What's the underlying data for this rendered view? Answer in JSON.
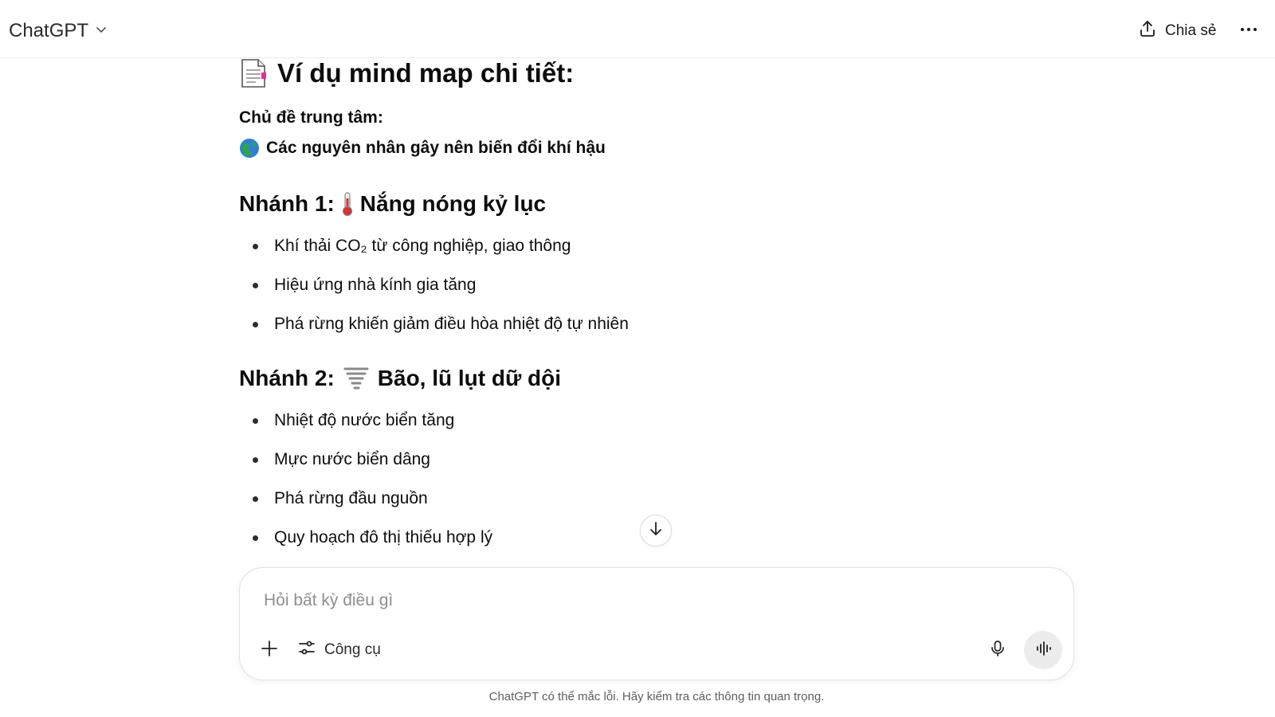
{
  "header": {
    "model_name": "ChatGPT",
    "share_label": "Chia sẻ"
  },
  "message": {
    "title": "Ví dụ mind map chi tiết:",
    "center_label": "Chủ đề trung tâm:",
    "center_topic": "Các nguyên nhân gây nên biến đổi khí hậu",
    "branches": [
      {
        "prefix": "Nhánh 1:",
        "name": "Nắng nóng kỷ lục",
        "icon": "thermometer-icon",
        "items": [
          "Khí thải CO₂ từ công nghiệp, giao thông",
          "Hiệu ứng nhà kính gia tăng",
          "Phá rừng khiến giảm điều hòa nhiệt độ tự nhiên"
        ]
      },
      {
        "prefix": "Nhánh 2:",
        "name": "Bão, lũ lụt dữ dội",
        "icon": "tornado-icon",
        "items": [
          "Nhiệt độ nước biển tăng",
          "Mực nước biển dâng",
          "Phá rừng đầu nguồn",
          "Quy hoạch đô thị thiếu hợp lý"
        ]
      }
    ]
  },
  "composer": {
    "placeholder": "Hỏi bất kỳ điều gì",
    "tools_label": "Công cụ"
  },
  "footer": {
    "disclaimer": "ChatGPT có thể mắc lỗi. Hãy kiểm tra các thông tin quan trọng."
  },
  "colors": {
    "accent_globe": "#1f8a4c",
    "thermometer_red": "#d93030",
    "muted_text": "#5d5d5d"
  }
}
